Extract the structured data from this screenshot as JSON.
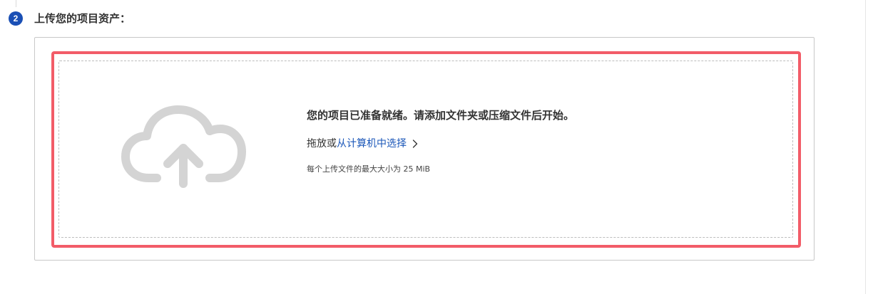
{
  "step": {
    "number": "2",
    "title": "上传您的项目资产："
  },
  "upload": {
    "ready_message": "您的项目已准备就绪。请添加文件夹或压缩文件后开始。",
    "drag_prefix": "拖放或",
    "choose_link": "从计算机中选择",
    "max_size_note": "每个上传文件的最大大小为 25 MiB",
    "icons": {
      "upload": "cloud-upload-icon",
      "chevron": "chevron-right-icon"
    }
  },
  "colors": {
    "highlight": "#f25c68",
    "link": "#1a56b8",
    "badge": "#1a4fb5",
    "cloud": "#d4d4d4"
  }
}
